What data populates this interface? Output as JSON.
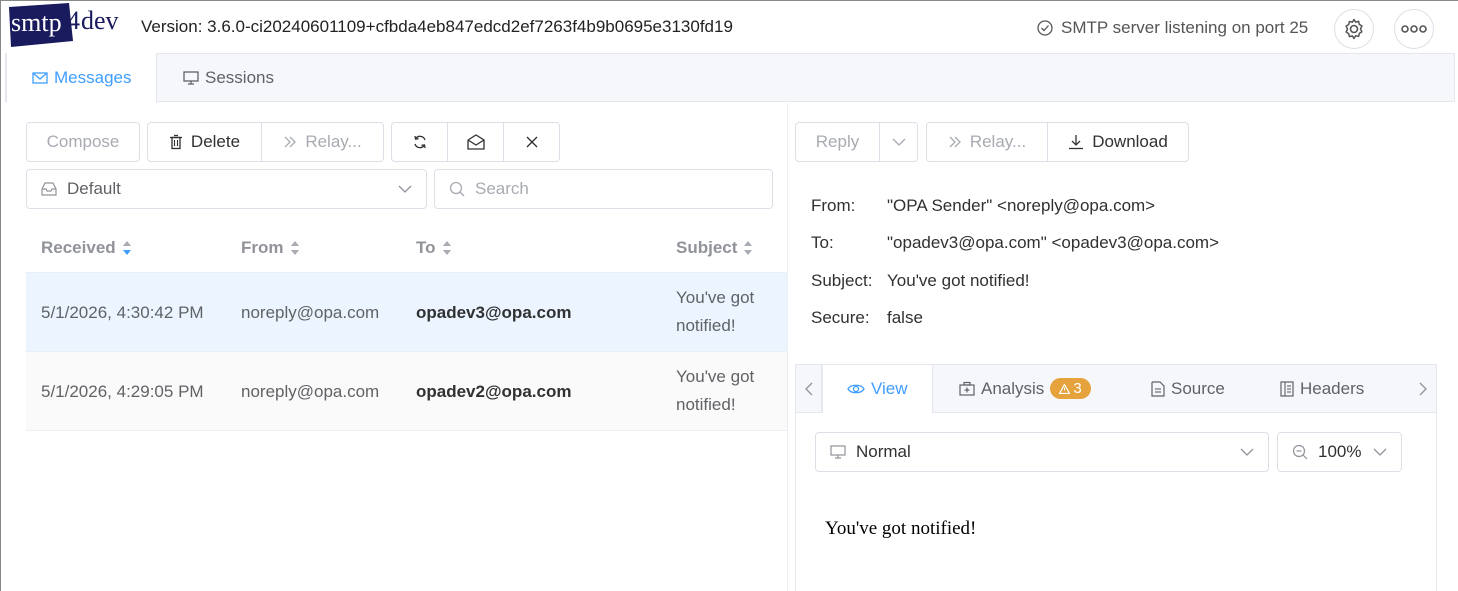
{
  "app": {
    "logo_text": "smtp4dev",
    "version": "Version: 3.6.0-ci20240601109+cfbda4eb847edcd2ef7263f4b9b0695e3130fd19",
    "status": "SMTP server listening on port 25"
  },
  "top_tabs": [
    {
      "label": "Messages",
      "icon": "envelope-icon",
      "active": true
    },
    {
      "label": "Sessions",
      "icon": "monitor-icon",
      "active": false
    }
  ],
  "toolbar": {
    "compose": "Compose",
    "delete": "Delete",
    "relay": "Relay..."
  },
  "mailbox": {
    "selected": "Default"
  },
  "search": {
    "placeholder": "Search"
  },
  "table": {
    "columns": [
      "Received",
      "From",
      "To",
      "Subject"
    ],
    "rows": [
      {
        "received": "5/1/2026, 4:30:42 PM",
        "from": "noreply@opa.com",
        "to": "opadev3@opa.com",
        "subject": "You've got notified!",
        "selected": true
      },
      {
        "received": "5/1/2026, 4:29:05 PM",
        "from": "noreply@opa.com",
        "to": "opadev2@opa.com",
        "subject": "You've got notified!",
        "selected": false
      }
    ]
  },
  "message_toolbar": {
    "reply": "Reply",
    "relay": "Relay...",
    "download": "Download"
  },
  "message": {
    "from_label": "From:",
    "from": "\"OPA Sender\" <noreply@opa.com>",
    "to_label": "To:",
    "to": "\"opadev3@opa.com\" <opadev3@opa.com>",
    "subject_label": "Subject:",
    "subject": "You've got notified!",
    "secure_label": "Secure:",
    "secure": "false",
    "body": "You've got notified!"
  },
  "detail_tabs": [
    {
      "label": "View",
      "active": true
    },
    {
      "label": "Analysis",
      "badge": "3"
    },
    {
      "label": "Source"
    },
    {
      "label": "Headers"
    }
  ],
  "view_options": {
    "mode": "Normal",
    "zoom": "100%"
  },
  "colors": {
    "accent": "#409eff",
    "warning": "#e6a23c",
    "selected_row": "#ecf5ff"
  }
}
